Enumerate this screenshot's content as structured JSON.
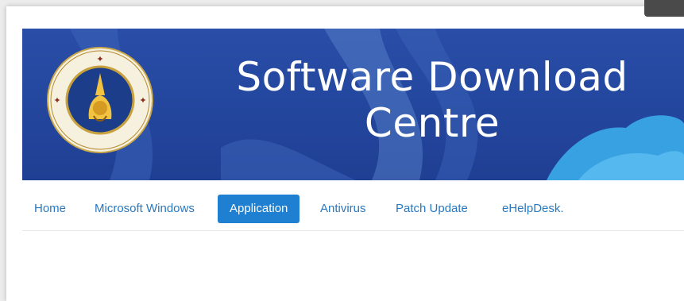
{
  "header": {
    "title_line1": "Software Download",
    "title_line2": "Centre",
    "banner_color": "#2a4ea8",
    "logo_icon": "university-seal-icon",
    "seal_text": "มหาวิทยาลัยมหิดล อตฺตานํ อุปมํ กเร"
  },
  "nav": {
    "items": [
      {
        "label": "Home",
        "active": false
      },
      {
        "label": "Microsoft Windows",
        "active": false
      },
      {
        "label": "Application",
        "active": true
      },
      {
        "label": "Antivirus",
        "active": false
      },
      {
        "label": "Patch Update",
        "active": false
      },
      {
        "label": "eHelpDesk.",
        "active": false
      }
    ],
    "link_color": "#2a78bf",
    "active_color": "#1f7fd1"
  }
}
